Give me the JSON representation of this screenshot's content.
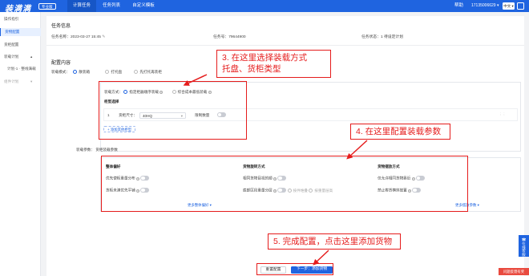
{
  "app": {
    "logo": "装满满",
    "edition": "专业版",
    "nav_tabs": [
      "计算任务",
      "任务列表",
      "自定义模板"
    ],
    "help": "帮助",
    "phone": "17135006629",
    "lang": "中文"
  },
  "sidebar": {
    "items": [
      {
        "label": "操作指引"
      },
      {
        "label": "货物配置"
      },
      {
        "label": "货柜配置"
      },
      {
        "label": "装载计划"
      },
      {
        "label": "计划-1 · 整线满载"
      },
      {
        "label": "组件计划"
      }
    ]
  },
  "task_info": {
    "title": "任务信息",
    "name_label": "任务名称：",
    "name_value": "2023-03-27 15:45",
    "no_label": "任务号：",
    "no_value": "79644900",
    "status_label": "任务状态：",
    "status_value": "1 待设定计划"
  },
  "config": {
    "title": "配置内容",
    "load_mode_label": "装载模式：",
    "load_modes": [
      "散装箱",
      "打托盘",
      "先打托再装柜"
    ],
    "load_method_label": "装载方式：",
    "load_methods": [
      "指定柜器顺序装载",
      "综合成本最低装载"
    ],
    "container_select_title": "柜型选择",
    "container_row_index": "1",
    "container_size_label": "货柜尺寸：",
    "container_size_value": "40HQ",
    "limit_label": "限制数量",
    "add_button": "+ 添加其他柜型",
    "load_params_label": "装载参数：",
    "load_params_value": "货柜装载参数",
    "groups": [
      {
        "title": "整体偏好",
        "items": [
          "优先使柜重量分布",
          "货柜未满优先平铺"
        ],
        "more": "更多整体偏好"
      },
      {
        "title": "货物旋转方式",
        "items": [
          "相同货物目视的顺",
          "底部区段重量分层"
        ],
        "sub_opts": [
          "按件堆叠",
          "按重量层高"
        ],
        "more": ""
      },
      {
        "title": "货物摆放方式",
        "items": [
          "仅允许相同货物靠近",
          "禁止客货横斜放置"
        ],
        "more": "更多摆放参数"
      }
    ]
  },
  "footer_buttons": {
    "reset": "重置配置",
    "next": "下一步：添加货物"
  },
  "annotations": {
    "step3_line1": "3. 在这里选择装载方式",
    "step3_line2": "托盘、货柜类型",
    "step4": "4. 在这里配置装载参数",
    "step5": "5. 完成配置，点击这里添加货物"
  },
  "floating": {
    "service": "在线客服",
    "feedback": "问题反馈有奖"
  },
  "colors": {
    "brand": "#1f64e0",
    "annotation_red": "#e51c1c"
  }
}
